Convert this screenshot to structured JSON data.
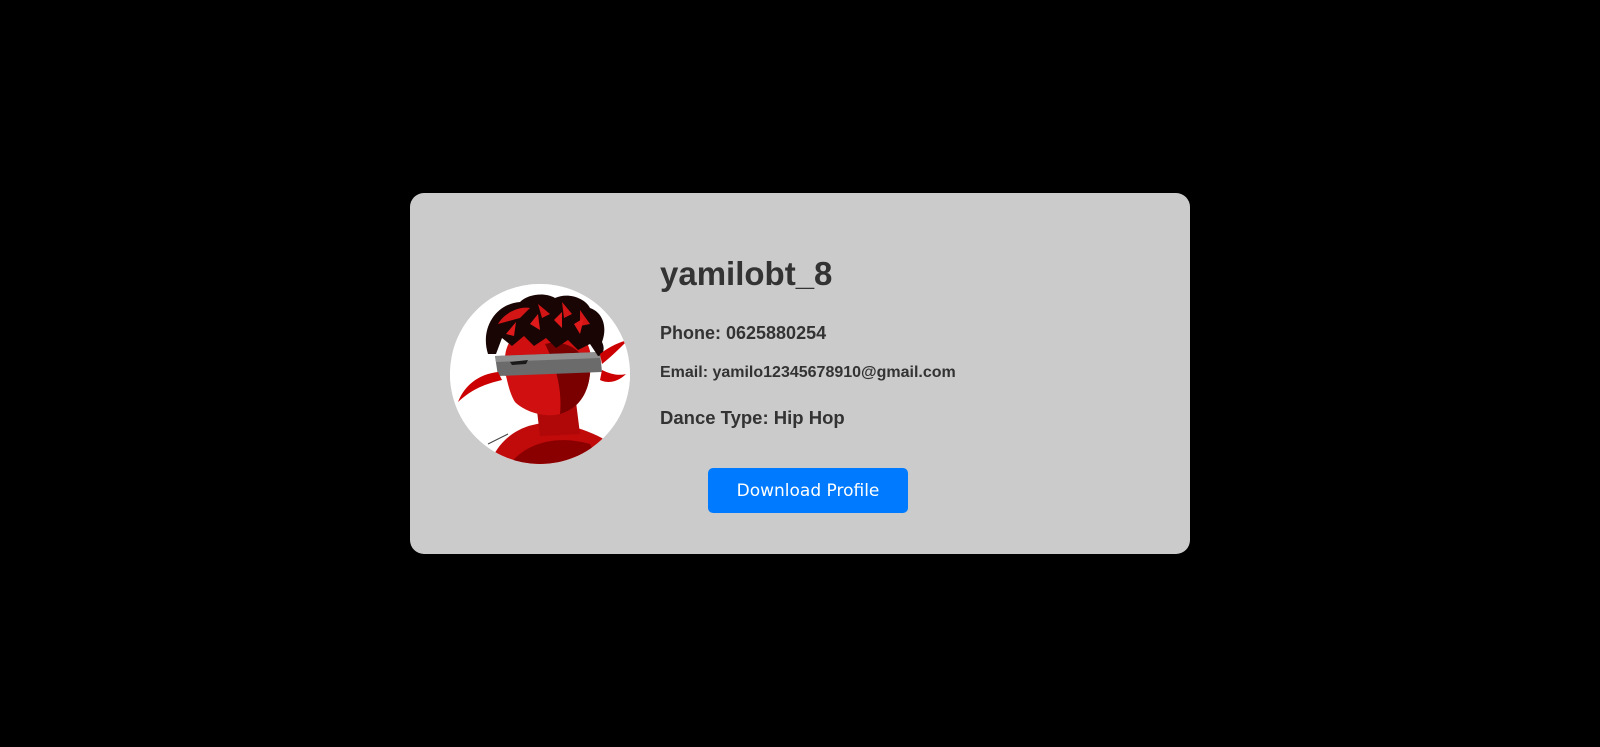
{
  "profile": {
    "username": "yamilobt_8",
    "phone": "Phone: 0625880254",
    "email": "Email: yamilo12345678910@gmail.com",
    "dance_type": "Dance Type: Hip Hop",
    "avatar_icon": "stylized-fighter-portrait"
  },
  "actions": {
    "download_label": "Download Profile"
  },
  "colors": {
    "page_background": "#000000",
    "card_background": "#cbcbcb",
    "text": "#333333",
    "button": "#007bff",
    "button_text": "#ffffff"
  }
}
